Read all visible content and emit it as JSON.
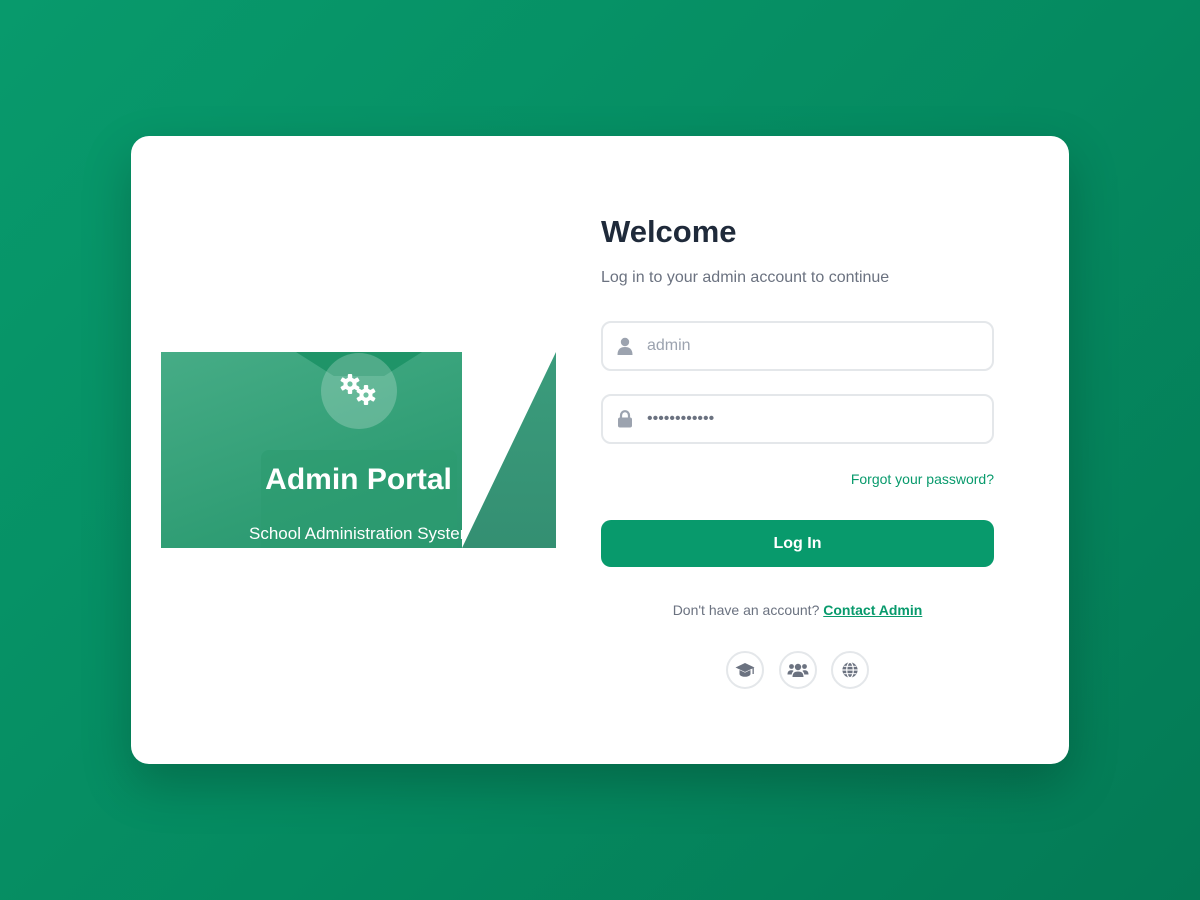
{
  "banner": {
    "title": "Admin Portal",
    "subtitle": "School Administration System",
    "icon": "gears-icon"
  },
  "form": {
    "heading": "Welcome",
    "subheading": "Log in to your admin account to continue",
    "username": {
      "value": "admin",
      "icon": "user-icon"
    },
    "password": {
      "value": "••••••••••••",
      "icon": "lock-icon"
    },
    "forgot_label": "Forgot your password?",
    "login_label": "Log In",
    "signup_prompt": "Don't have an account?",
    "signup_link": "Contact Admin"
  },
  "social_icons": [
    "graduation-cap-icon",
    "users-icon",
    "globe-icon"
  ],
  "colors": {
    "brand": "#089a6c",
    "text_dark": "#1f2a3a",
    "text_muted": "#6b7280"
  }
}
